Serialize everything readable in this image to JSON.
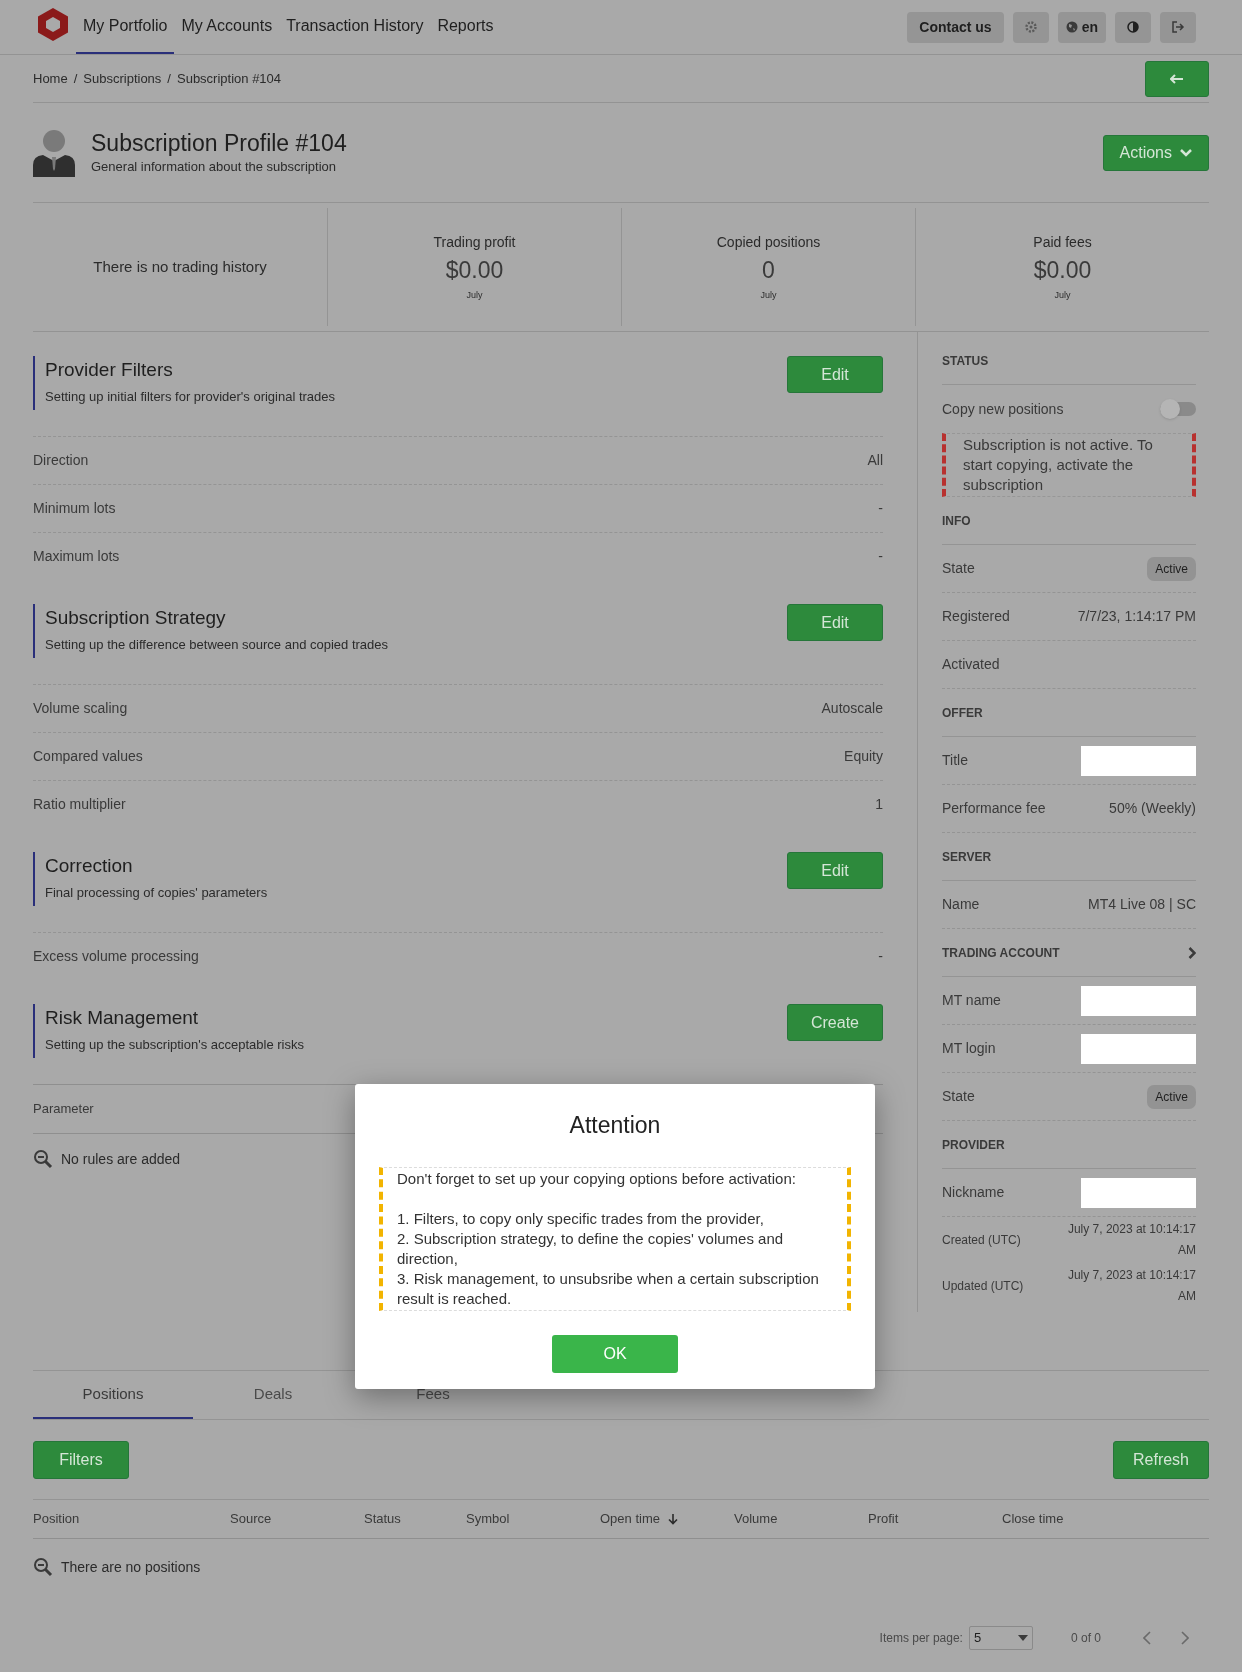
{
  "nav": {
    "items": [
      {
        "label": "My Portfolio",
        "selected": true
      },
      {
        "label": "My Accounts",
        "selected": false
      },
      {
        "label": "Transaction History",
        "selected": false
      },
      {
        "label": "Reports",
        "selected": false
      }
    ],
    "buttons": [
      {
        "kind": "text",
        "label": "Contact us"
      },
      {
        "kind": "settings"
      },
      {
        "kind": "language",
        "label": "en"
      },
      {
        "kind": "theme"
      },
      {
        "kind": "logout"
      }
    ]
  },
  "breadcrumb": {
    "separator": "/",
    "items": [
      "Home",
      "Subscriptions",
      "Subscription #104"
    ]
  },
  "header": {
    "title": "Subscription Profile #104",
    "subtitle": "General information about the subscription",
    "actions": "Actions"
  },
  "stats": {
    "empty_text": "There is no trading history",
    "items": [
      {
        "label": "Trading profit",
        "value": "$0.00",
        "period": "July"
      },
      {
        "label": "Copied positions",
        "value": "0",
        "period": "July"
      },
      {
        "label": "Paid fees",
        "value": "$0.00",
        "period": "July"
      }
    ]
  },
  "sections": [
    {
      "kind": "rows",
      "title": "Provider Filters",
      "subtitle": "Setting up initial filters for provider's original trades",
      "button": "Edit",
      "rows": [
        {
          "label": "Direction",
          "value": "All"
        },
        {
          "label": "Minimum lots",
          "value": "-"
        },
        {
          "label": "Maximum lots",
          "value": "-"
        }
      ]
    },
    {
      "kind": "rows",
      "title": "Subscription Strategy",
      "subtitle": "Setting up the difference between source and copied trades",
      "button": "Edit",
      "rows": [
        {
          "label": "Volume scaling",
          "value": "Autoscale"
        },
        {
          "label": "Compared values",
          "value": "Equity"
        },
        {
          "label": "Ratio multiplier",
          "value": "1"
        }
      ]
    },
    {
      "kind": "rows",
      "title": "Correction",
      "subtitle": "Final processing of copies' parameters",
      "button": "Edit",
      "rows": [
        {
          "label": "Excess volume processing",
          "value": "-"
        }
      ]
    },
    {
      "kind": "rules",
      "title": "Risk Management",
      "subtitle": "Setting up the subscription's acceptable risks",
      "button": "Create",
      "columns": [
        "Parameter"
      ],
      "empty": "No rules are added"
    }
  ],
  "sidebar": [
    {
      "title": "STATUS",
      "link": false,
      "rows": [
        {
          "kind": "toggle",
          "label": "Copy new positions",
          "on": false
        },
        {
          "kind": "alert",
          "text": "Subscription is not active. To start copying, activate the subscription"
        }
      ]
    },
    {
      "title": "INFO",
      "link": false,
      "rows": [
        {
          "kind": "badge",
          "label": "State",
          "value": "Active"
        },
        {
          "kind": "text",
          "label": "Registered",
          "value": "7/7/23, 1:14:17 PM"
        },
        {
          "kind": "text",
          "label": "Activated"
        }
      ]
    },
    {
      "title": "OFFER",
      "link": false,
      "rows": [
        {
          "kind": "redacted",
          "label": "Title"
        },
        {
          "kind": "text",
          "label": "Performance fee",
          "value": "50% (Weekly)"
        }
      ]
    },
    {
      "title": "SERVER",
      "link": false,
      "rows": [
        {
          "kind": "text",
          "label": "Name",
          "value": "MT4 Live 08 | SC"
        }
      ]
    },
    {
      "title": "TRADING ACCOUNT",
      "link": true,
      "rows": [
        {
          "kind": "redacted",
          "label": "MT name"
        },
        {
          "kind": "redacted",
          "label": "MT login"
        },
        {
          "kind": "badge",
          "label": "State",
          "value": "Active"
        }
      ]
    },
    {
      "title": "PROVIDER",
      "link": false,
      "rows": [
        {
          "kind": "redacted",
          "label": "Nickname"
        },
        {
          "kind": "meta",
          "label": "Created (UTC)",
          "value": "July 7, 2023 at 10:14:17 AM"
        },
        {
          "kind": "meta",
          "label": "Updated (UTC)",
          "value": "July 7, 2023 at 10:14:17 AM"
        }
      ]
    }
  ],
  "tabs": [
    {
      "label": "Positions",
      "selected": true
    },
    {
      "label": "Deals",
      "selected": false
    },
    {
      "label": "Fees",
      "selected": false
    }
  ],
  "toolbar": {
    "filters": "Filters",
    "refresh": "Refresh"
  },
  "table": {
    "columns": [
      {
        "label": "Position",
        "sorted": false
      },
      {
        "label": "Source",
        "sorted": false
      },
      {
        "label": "Status",
        "sorted": false
      },
      {
        "label": "Symbol",
        "sorted": false
      },
      {
        "label": "Open time",
        "sorted": true
      },
      {
        "label": "Volume",
        "sorted": false
      },
      {
        "label": "Profit",
        "sorted": false
      },
      {
        "label": "Close time",
        "sorted": false
      }
    ],
    "empty": "There are no positions"
  },
  "pagination": {
    "label": "Items per page:",
    "per_page": "5",
    "range": "0 of 0"
  },
  "modal": {
    "title": "Attention",
    "intro": "Don't forget to set up your copying options before activation:",
    "items": [
      "1. Filters, to copy only specific trades from the provider,",
      "2. Subscription strategy, to define the copies' volumes and direction,",
      "3. Risk management, to unsubsribe when a certain subscription result is reached."
    ],
    "button": "OK"
  }
}
